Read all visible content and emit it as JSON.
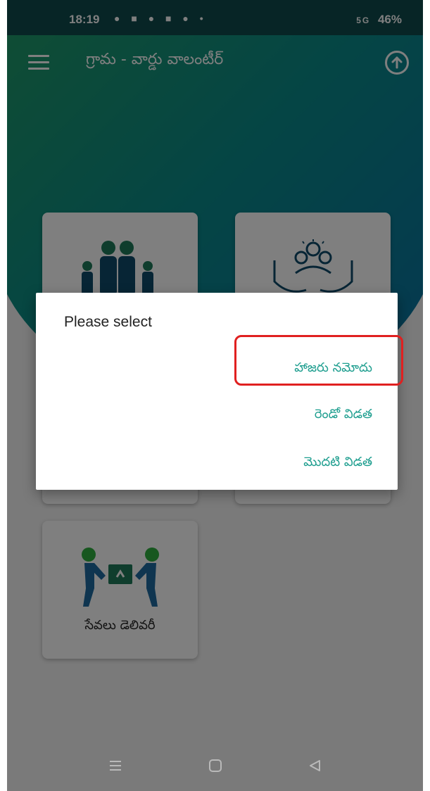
{
  "status_bar": {
    "time": "18:19",
    "icons": "● ■ ● ■ ● •",
    "signal": "5G",
    "battery": "46%"
  },
  "app_bar": {
    "title": "గ్రామ - వార్డు వాలంటీర్"
  },
  "cards": [
    {
      "label": "",
      "icon": "family-icon"
    },
    {
      "label": "",
      "icon": "community-care-icon"
    },
    {
      "label": "సేవలు డెలివరీ",
      "icon": "delivery-icon"
    }
  ],
  "dialog": {
    "title": "Please select",
    "options": [
      "హాజరు నమోదు",
      "రెండో విడత",
      "మొదటి విడత"
    ]
  },
  "colors": {
    "status_bar": "#0f4a4c",
    "accent": "#1e9e8f",
    "highlight": "#e02020",
    "person": "#1e7a5a"
  }
}
